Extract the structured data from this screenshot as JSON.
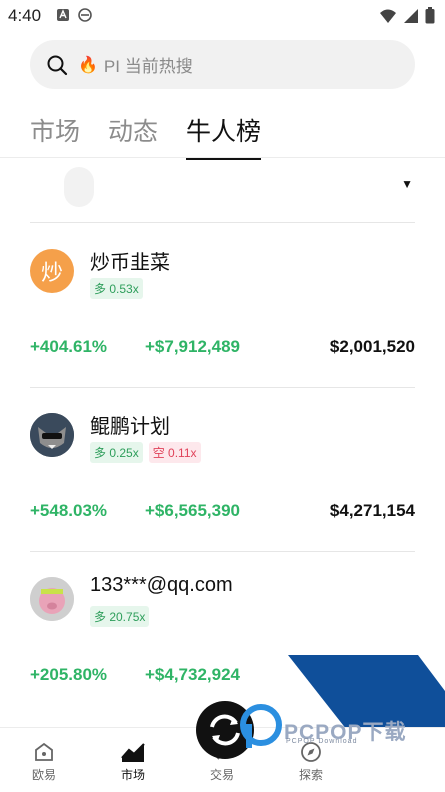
{
  "status_bar": {
    "time": "4:40"
  },
  "search": {
    "fire_icon": "🔥",
    "placeholder": "PI 当前热搜"
  },
  "tabs": [
    {
      "label": "市场",
      "active": false
    },
    {
      "label": "动态",
      "active": false
    },
    {
      "label": "牛人榜",
      "active": true
    }
  ],
  "traders": [
    {
      "avatar_text": "炒",
      "name": "炒币韭菜",
      "long_badge": "多 0.53x",
      "short_badge": "",
      "roi": "+404.61%",
      "pnl": "+$7,912,489",
      "aum": "$2,001,520"
    },
    {
      "avatar_text": "",
      "name": "鲲鹏计划",
      "long_badge": "多 0.25x",
      "short_badge": "空 0.11x",
      "roi": "+548.03%",
      "pnl": "+$6,565,390",
      "aum": "$4,271,154"
    },
    {
      "avatar_text": "",
      "name": "133***@qq.com",
      "long_badge": "多 20.75x",
      "short_badge": "",
      "roi": "+205.80%",
      "pnl": "+$4,732,924",
      "aum": ""
    }
  ],
  "bottom_nav": [
    {
      "label": "欧易",
      "icon": "home-icon",
      "active": false
    },
    {
      "label": "市场",
      "icon": "chart-icon",
      "active": true
    },
    {
      "label": "交易",
      "icon": "trade-icon",
      "active": false
    },
    {
      "label": "探索",
      "icon": "compass-icon",
      "active": false
    }
  ],
  "watermark": {
    "text": "PCPOP下载",
    "sub": "PCPOP Download"
  },
  "colors": {
    "positive": "#2fb466",
    "short": "#e0435a",
    "avatar_orange": "#f5a04a",
    "stripe_blue": "#0f4f9a"
  }
}
